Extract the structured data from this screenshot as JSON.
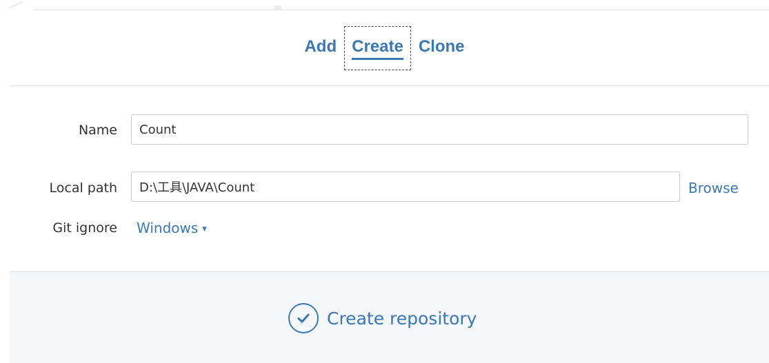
{
  "tabs": [
    {
      "label": "Add"
    },
    {
      "label": "Create",
      "active": true
    },
    {
      "label": "Clone"
    }
  ],
  "form": {
    "name_label": "Name",
    "name_value": "Count",
    "path_label": "Local path",
    "path_value": "D:\\工具\\JAVA\\Count",
    "browse_label": "Browse",
    "gitignore_label": "Git ignore",
    "gitignore_value": "Windows",
    "gitignore_caret": "▾"
  },
  "footer": {
    "create_label": "Create repository"
  },
  "colors": {
    "accent": "#3a78b4",
    "footer_bg": "#f5f6f7"
  },
  "icons": {
    "create": "check-circle-icon",
    "dropdown": "caret-down-icon"
  }
}
